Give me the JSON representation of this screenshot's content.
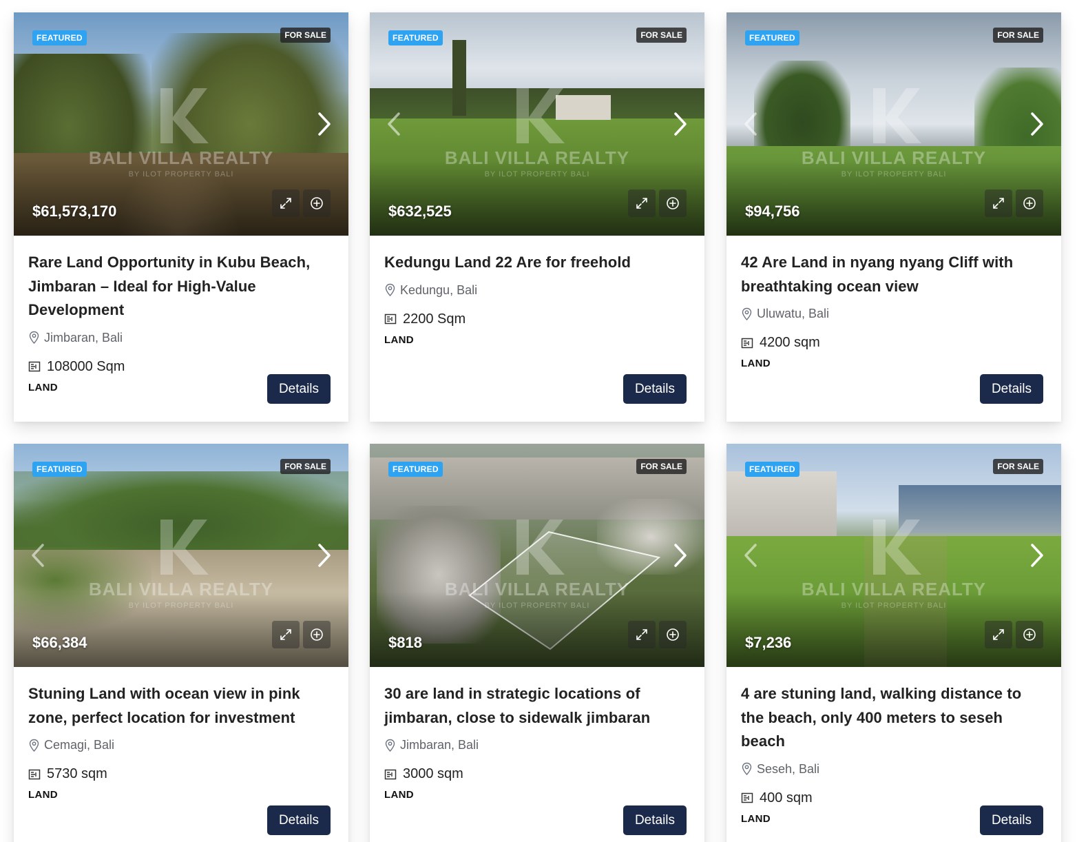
{
  "badges": {
    "featured": "FEATURED",
    "sale": "FOR SALE"
  },
  "watermark": {
    "name": "BALI VILLA REALTY",
    "sub": "BY ILOT PROPERTY BALI"
  },
  "details_label": "Details",
  "colors": {
    "featured_badge": "#2ea3f2",
    "details_button": "#1b2a4a"
  },
  "listings": [
    {
      "price": "$61,573,170",
      "title": "Rare Land Opportunity in Kubu Beach, Jimbaran – Ideal for High-Value Development",
      "location": "Jimbaran, Bali",
      "size": "108000 Sqm",
      "type": "LAND"
    },
    {
      "price": "$632,525",
      "title": "Kedungu Land 22 Are for freehold",
      "location": "Kedungu, Bali",
      "size": "2200 Sqm",
      "type": "LAND"
    },
    {
      "price": "$94,756",
      "title": "42 Are Land in nyang nyang Cliff with breathtaking ocean view",
      "location": "Uluwatu, Bali",
      "size": "4200 sqm",
      "type": "LAND"
    },
    {
      "price": "$66,384",
      "title": "Stuning Land with ocean view in pink zone, perfect location for investment",
      "location": "Cemagi, Bali",
      "size": "5730 sqm",
      "type": "LAND"
    },
    {
      "price": "$818",
      "title": "30 are land in strategic locations of jimbaran, close to sidewalk jimbaran",
      "location": "Jimbaran, Bali",
      "size": "3000 sqm",
      "type": "LAND"
    },
    {
      "price": "$7,236",
      "title": "4 are stuning land, walking distance to the beach, only 400 meters to seseh beach",
      "location": "Seseh, Bali",
      "size": "400 sqm",
      "type": "LAND"
    }
  ]
}
